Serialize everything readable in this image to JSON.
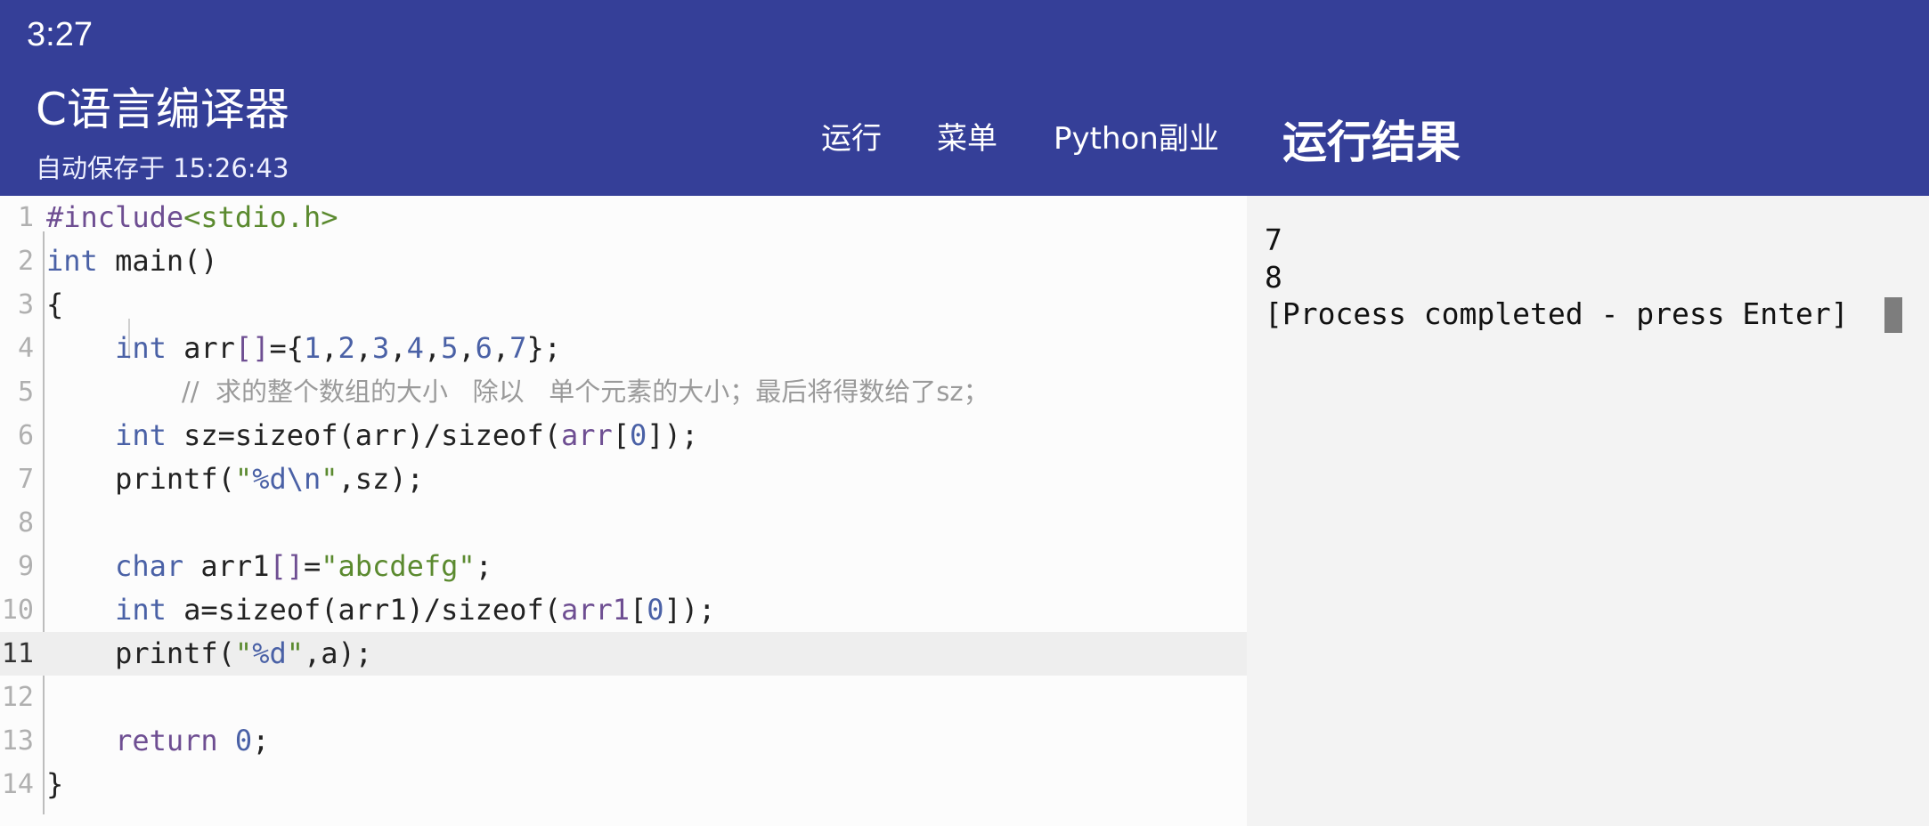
{
  "status_bar": {
    "time": "3:27"
  },
  "app_bar": {
    "title": "C语言编译器",
    "autosave": "自动保存于 15:26:43",
    "menu": [
      {
        "label": "运行"
      },
      {
        "label": "菜单"
      },
      {
        "label": "Python副业"
      }
    ],
    "results_title": "运行结果"
  },
  "editor": {
    "current_line": 11,
    "line_numbers": [
      "1",
      "2",
      "3",
      "4",
      "5",
      "6",
      "7",
      "8",
      "9",
      "10",
      "11",
      "12",
      "13",
      "14"
    ],
    "lines": [
      "#include<stdio.h>",
      "int main()",
      "{",
      "    int arr[]={1,2,3,4,5,6,7};",
      "      //  求的整个数组的大小   除以   单个元素的大小；最后将得数给了sz；",
      "    int sz=sizeof(arr)/sizeof(arr[0]);",
      "    printf(\"%d\\n\",sz);",
      "",
      "    char arr1[]=\"abcdefg\";",
      "    int a=sizeof(arr1)/sizeof(arr1[0]);",
      "    printf(\"%d\",a);",
      "",
      "    return 0;",
      "}"
    ]
  },
  "output": {
    "lines": [
      "7",
      "8",
      "[Process completed - press Enter]"
    ]
  },
  "colors": {
    "app_bar": "#353f98",
    "keyword": "#4a61a6",
    "preprocessor": "#6e4e92",
    "string": "#5b8a2f",
    "comment": "#9a9a9a"
  }
}
